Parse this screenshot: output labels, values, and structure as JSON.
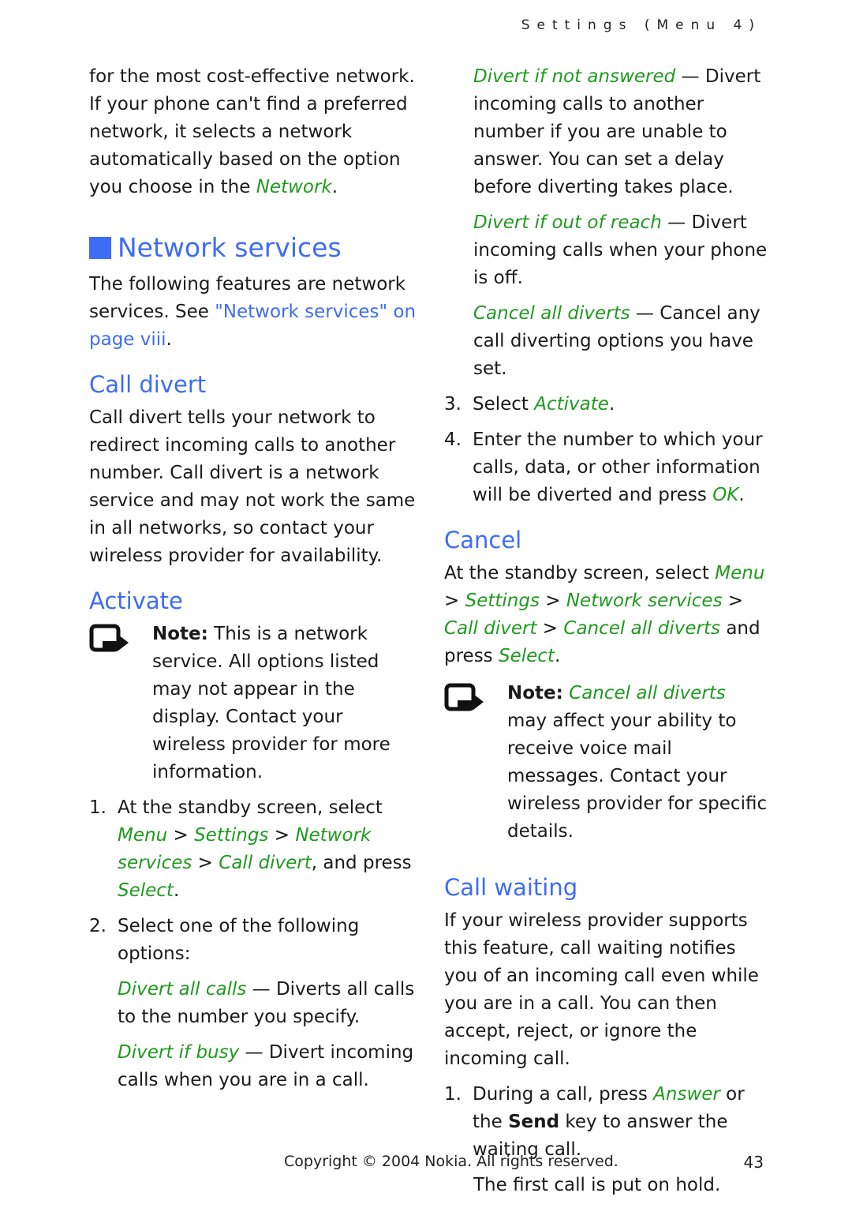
{
  "header": {
    "running_head": "Settings (Menu 4)"
  },
  "left": {
    "intro": {
      "t1": "for the most cost-effective network. If your phone can't find a preferred network, it selects a network automatically based on the option you choose in the ",
      "link": "Network",
      "t2": "."
    },
    "section_title": "Network services",
    "section_para": {
      "t1": "The following features are network services. See ",
      "link": "\"Network services\" on page viii",
      "t2": "."
    },
    "call_divert_title": "Call divert",
    "call_divert_para": "Call divert tells your network to redirect incoming calls to another number. Call divert is a network service and may not work the same in all networks, so contact your wireless provider for availability.",
    "activate_title": "Activate",
    "note": {
      "label": "Note:",
      "text": " This is a network service. All options listed may not appear in the display. Contact your wireless provider for more information."
    },
    "step1": {
      "num": "1.",
      "t1": "At the standby screen, select ",
      "m1": "Menu",
      "sep1": " > ",
      "m2": "Settings",
      "sep2": " > ",
      "m3": "Network services",
      "sep3": " > ",
      "m4": "Call divert",
      "t2": ", and press ",
      "m5": "Select",
      "t3": "."
    },
    "step2": {
      "num": "2.",
      "text": "Select one of the following options:"
    },
    "options": [
      {
        "name": "Divert all calls",
        "desc": " — Diverts all calls to the number you specify."
      },
      {
        "name": "Divert if busy",
        "desc": " — Divert incoming calls when you are in a call."
      }
    ]
  },
  "right": {
    "options": [
      {
        "name": "Divert if not answered",
        "desc": " — Divert incoming calls to another number if you are unable to answer. You can set a delay before diverting takes place."
      },
      {
        "name": "Divert if out of reach",
        "desc": " — Divert incoming calls when your phone is off."
      },
      {
        "name": "Cancel all diverts",
        "desc": " — Cancel any call diverting options you have set."
      }
    ],
    "step3": {
      "num": "3.",
      "t1": "Select ",
      "m1": "Activate",
      "t2": "."
    },
    "step4": {
      "num": "4.",
      "t1": "Enter the number to which your calls, data, or other information will be diverted and press ",
      "m1": "OK",
      "t2": "."
    },
    "cancel_title": "Cancel",
    "cancel_para": {
      "t1": "At the standby screen, select ",
      "m1": "Menu",
      "sep1": " > ",
      "m2": "Settings",
      "sep2": " > ",
      "m3": "Network services",
      "sep3": " > ",
      "m4": "Call divert",
      "sep4": " > ",
      "m5": "Cancel all diverts",
      "t2": " and press ",
      "m6": "Select",
      "t3": "."
    },
    "note": {
      "label": "Note:",
      "link": "Cancel all diverts",
      "text": " may affect your ability to receive voice mail messages. Contact your wireless provider for specific details."
    },
    "call_waiting_title": "Call waiting",
    "call_waiting_para": "If your wireless provider supports this feature, call waiting notifies you of an incoming call even while you are in a call. You can then accept, reject, or ignore the incoming call.",
    "cw_step1": {
      "num": "1.",
      "t1": "During a call, press ",
      "m1": "Answer",
      "t2": " or the ",
      "bold": "Send",
      "t3": " key to answer the waiting call."
    },
    "cw_after": "The first call is put on hold."
  },
  "footer": {
    "copyright": "Copyright © 2004 Nokia. All rights reserved.",
    "page_number": "43"
  },
  "colors": {
    "heading_blue": "#3d6cf5",
    "menu_green": "#1f9a1f",
    "text": "#1a1a1a"
  }
}
